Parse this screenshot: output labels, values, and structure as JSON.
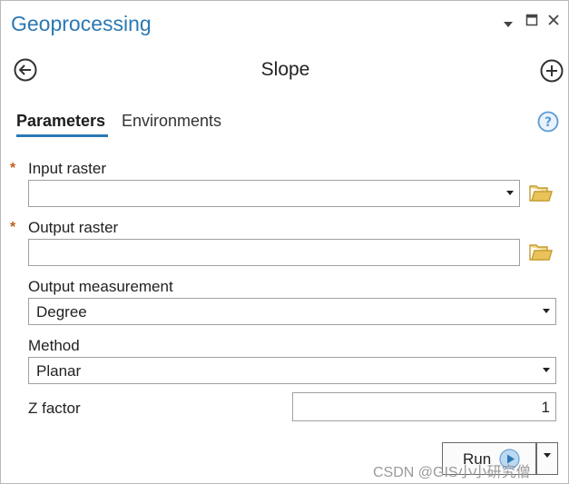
{
  "pane": {
    "title": "Geoprocessing",
    "menu_icon": "triangle-down",
    "maximize_icon": "square",
    "close_icon": "x"
  },
  "tool": {
    "title": "Slope",
    "back_icon": "arrow-left-circle",
    "add_icon": "plus-circle"
  },
  "tabs": [
    {
      "label": "Parameters",
      "active": true
    },
    {
      "label": "Environments",
      "active": false
    }
  ],
  "help_icon": "question-circle",
  "params": {
    "input_raster": {
      "label": "Input raster",
      "required": "*",
      "value": ""
    },
    "output_raster": {
      "label": "Output raster",
      "required": "*",
      "value": ""
    },
    "output_measurement": {
      "label": "Output measurement",
      "value": "Degree"
    },
    "method": {
      "label": "Method",
      "value": "Planar"
    },
    "z_factor": {
      "label": "Z factor",
      "value": "1"
    }
  },
  "run": {
    "label": "Run"
  },
  "watermark": "CSDN @GIS小小研究僧",
  "colors": {
    "accent": "#2b78b4",
    "required_marker": "#c05f1c",
    "folder": "#d9b24c",
    "border": "#a0a0a0"
  }
}
